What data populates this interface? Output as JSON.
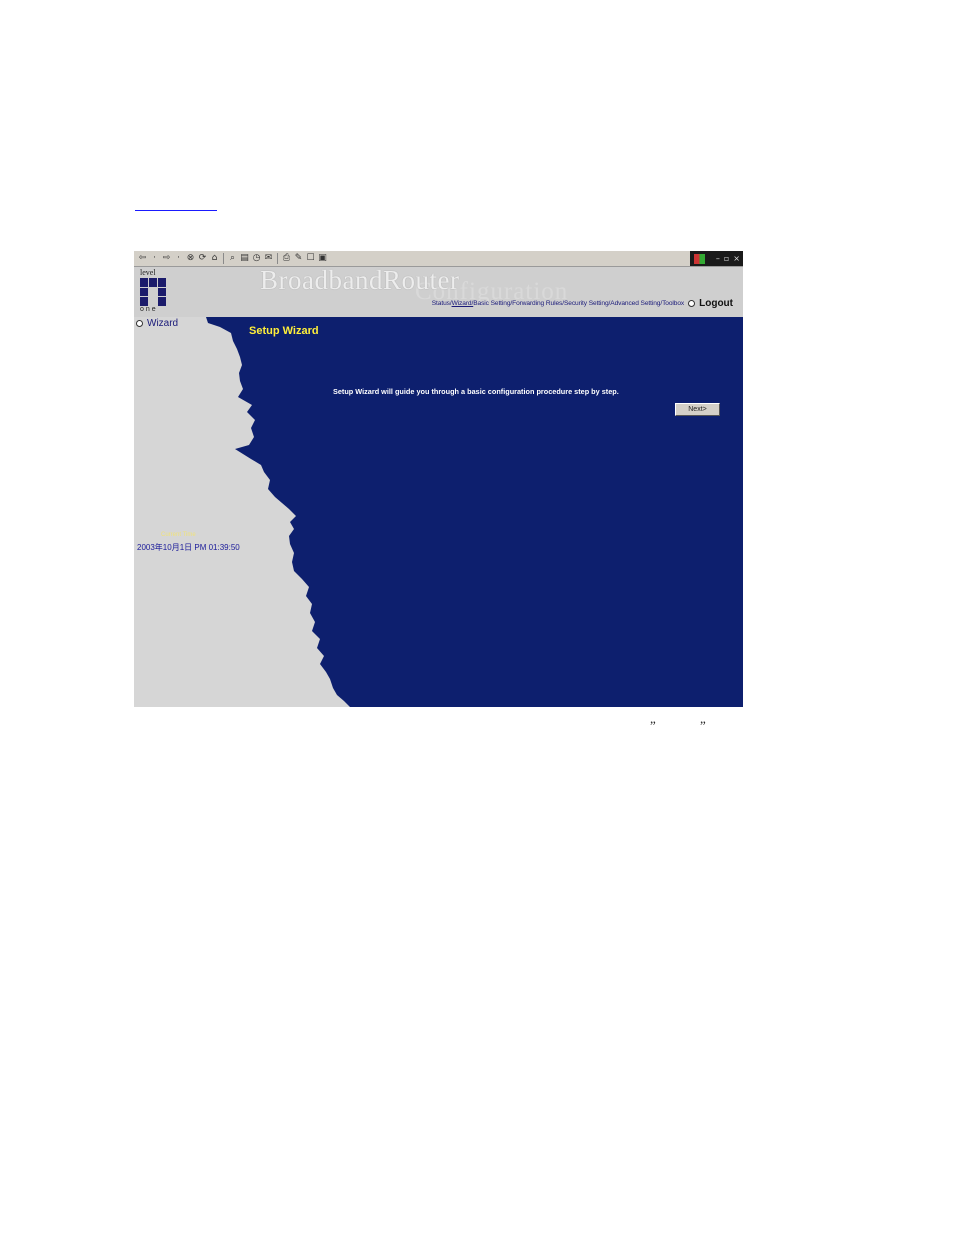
{
  "header": {
    "brand": "BroadbandRouter",
    "brand_sub": "Configuration",
    "logo_top": "level",
    "logo_bottom": "one",
    "nav": [
      {
        "label": "Status/",
        "active": false
      },
      {
        "label": "Wizard/",
        "active": true
      },
      {
        "label": "Basic Setting/",
        "active": false
      },
      {
        "label": "Forwarding Rules/",
        "active": false
      },
      {
        "label": "Security Setting/",
        "active": false
      },
      {
        "label": "Advanced Setting/",
        "active": false
      },
      {
        "label": "Toolbox",
        "active": false
      }
    ],
    "logout": "Logout"
  },
  "sidebar": {
    "wizard": "Wizard",
    "current_time_label": "Current Time",
    "current_time_value": "2003年10月1日 PM 01:39:50"
  },
  "main": {
    "title": "Setup Wizard",
    "description": "Setup Wizard will guide you through a basic configuration procedure step by step.",
    "next_label": "Next>"
  },
  "caption": {
    "quote1": "”",
    "quote2": "”"
  },
  "icons": [
    "back-icon",
    "forward-icon",
    "stop-icon",
    "refresh-icon",
    "home-icon",
    "search-icon",
    "favorites-icon",
    "history-icon",
    "mail-icon",
    "print-icon",
    "edit-icon",
    "discuss-icon",
    "messenger-icon"
  ],
  "colors": {
    "content_blue": "#0d1f6e",
    "sidebar_gray": "#d6d6d6",
    "title_yellow": "#ffef3a"
  }
}
